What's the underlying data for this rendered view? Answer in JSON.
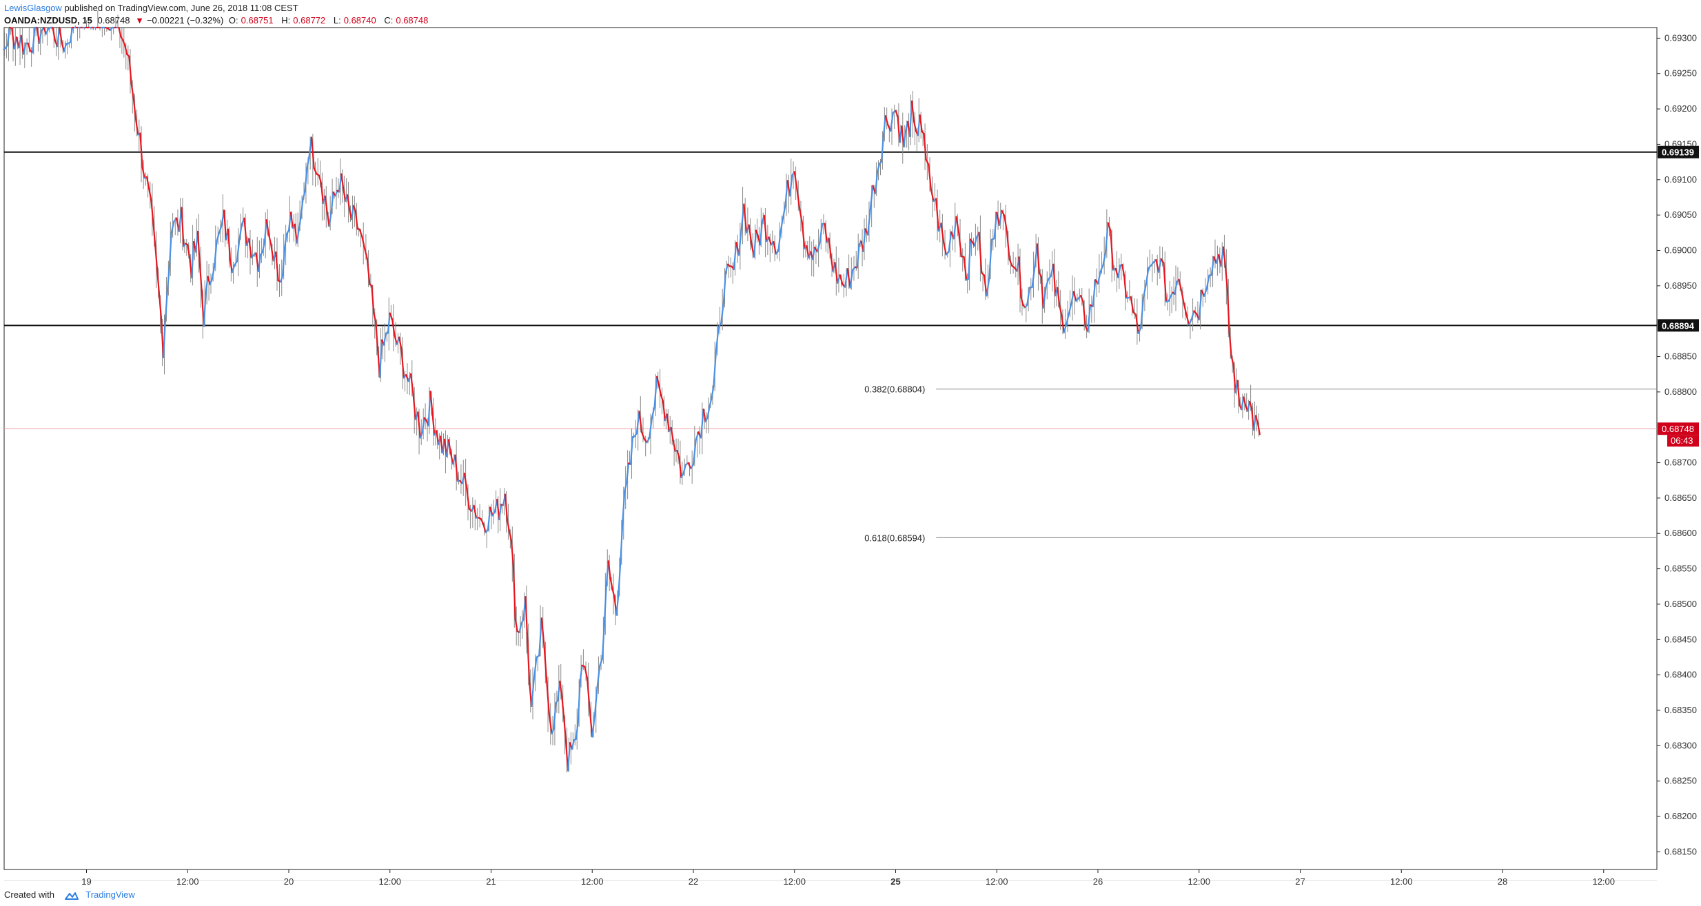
{
  "header": {
    "author": "LewisGlasgow",
    "published_text": " published on TradingView.com, June 26, 2018 11:08 CEST"
  },
  "ticker": {
    "symbol": "OANDA:NZDUSD, 15",
    "last": "0.68748",
    "change": "−0.00221 (−0.32%)",
    "o_label": "O:",
    "o_value": "0.68751",
    "h_label": "H:",
    "h_value": "0.68772",
    "l_label": "L:",
    "l_value": "0.68740",
    "c_label": "C:",
    "c_value": "0.68748",
    "down_icon": "triangle-down-icon"
  },
  "footer": {
    "created_with": "Created with",
    "brand": "TradingView",
    "logo_icon": "tradingview-cloud-icon"
  },
  "colors": {
    "up": "#4a90e2",
    "down": "#e5171f",
    "wick": "#8a8a8a",
    "price_line": "#f3a0a5",
    "last_price_bg": "#d0021b",
    "level_bg": "#111111",
    "grid_axis": "#222222"
  },
  "chart_data": {
    "type": "line",
    "instrument": "OANDA:NZDUSD",
    "timeframe": "15",
    "ylim": [
      0.68125,
      0.69315
    ],
    "y_ticks": [
      "0.69300",
      "0.69250",
      "0.69200",
      "0.69150",
      "0.69100",
      "0.69050",
      "0.69000",
      "0.68950",
      "0.68850",
      "0.68800",
      "0.68700",
      "0.68650",
      "0.68600",
      "0.68550",
      "0.68500",
      "0.68450",
      "0.68400",
      "0.68350",
      "0.68300",
      "0.68250",
      "0.68200",
      "0.68150"
    ],
    "y_tick_values": [
      0.693,
      0.6925,
      0.692,
      0.6915,
      0.691,
      0.6905,
      0.69,
      0.6895,
      0.6885,
      0.688,
      0.687,
      0.6865,
      0.686,
      0.6855,
      0.685,
      0.6845,
      0.684,
      0.6835,
      0.683,
      0.6825,
      0.682,
      0.6815
    ],
    "xlim": [
      -0.5,
      5.9
    ],
    "x_ticks": [
      {
        "label": "19",
        "x": 0,
        "bold": false
      },
      {
        "label": "12:00",
        "x": 0.5,
        "bold": false
      },
      {
        "label": "20",
        "x": 1,
        "bold": false
      },
      {
        "label": "12:00",
        "x": 1.5,
        "bold": false
      },
      {
        "label": "21",
        "x": 2,
        "bold": false
      },
      {
        "label": "12:00",
        "x": 2.5,
        "bold": false
      },
      {
        "label": "22",
        "x": 3,
        "bold": false
      },
      {
        "label": "12:00",
        "x": 3.5,
        "bold": false
      },
      {
        "label": "25",
        "x": 4,
        "bold": true
      },
      {
        "label": "12:00",
        "x": 4.5,
        "bold": false
      },
      {
        "label": "26",
        "x": 5,
        "bold": false
      },
      {
        "label": "12:00",
        "x": 5.5,
        "bold": false
      },
      {
        "label": "27",
        "x": 6,
        "bold": false
      },
      {
        "label": "12:00",
        "x": 6.5,
        "bold": false
      },
      {
        "label": "28",
        "x": 7,
        "bold": false
      },
      {
        "label": "12:00",
        "x": 7.5,
        "bold": false
      }
    ],
    "price_path": [
      [
        -0.5,
        0.6933
      ],
      [
        -0.42,
        0.6927
      ],
      [
        -0.38,
        0.6931
      ],
      [
        -0.3,
        0.6929
      ],
      [
        -0.2,
        0.6932
      ],
      [
        -0.1,
        0.6929
      ],
      [
        -0.05,
        0.6934
      ],
      [
        0.15,
        0.6933
      ],
      [
        0.2,
        0.6928
      ],
      [
        0.32,
        0.6905
      ],
      [
        0.35,
        0.6896
      ],
      [
        0.38,
        0.6887
      ],
      [
        0.42,
        0.6903
      ],
      [
        0.47,
        0.6904
      ],
      [
        0.52,
        0.6898
      ],
      [
        0.55,
        0.6901
      ],
      [
        0.58,
        0.6891
      ],
      [
        0.62,
        0.6898
      ],
      [
        0.68,
        0.6904
      ],
      [
        0.72,
        0.6899
      ],
      [
        0.78,
        0.6903
      ],
      [
        0.85,
        0.6899
      ],
      [
        0.9,
        0.6904
      ],
      [
        0.96,
        0.6896
      ],
      [
        1.0,
        0.6905
      ],
      [
        1.05,
        0.6901
      ],
      [
        1.1,
        0.6915
      ],
      [
        1.15,
        0.6912
      ],
      [
        1.2,
        0.6904
      ],
      [
        1.25,
        0.691
      ],
      [
        1.3,
        0.6905
      ],
      [
        1.35,
        0.6903
      ],
      [
        1.4,
        0.6895
      ],
      [
        1.45,
        0.6884
      ],
      [
        1.5,
        0.689
      ],
      [
        1.58,
        0.6883
      ],
      [
        1.65,
        0.6875
      ],
      [
        1.7,
        0.6878
      ],
      [
        1.75,
        0.6873
      ],
      [
        1.8,
        0.6871
      ],
      [
        1.88,
        0.6866
      ],
      [
        1.95,
        0.6862
      ],
      [
        2.03,
        0.6863
      ],
      [
        2.07,
        0.6866
      ],
      [
        2.09,
        0.6862
      ],
      [
        2.13,
        0.6846
      ],
      [
        2.17,
        0.685
      ],
      [
        2.2,
        0.6835
      ],
      [
        2.25,
        0.6846
      ],
      [
        2.3,
        0.6833
      ],
      [
        2.35,
        0.6838
      ],
      [
        2.38,
        0.6828
      ],
      [
        2.42,
        0.683
      ],
      [
        2.45,
        0.6843
      ],
      [
        2.5,
        0.6832
      ],
      [
        2.55,
        0.6844
      ],
      [
        2.58,
        0.6855
      ],
      [
        2.62,
        0.6849
      ],
      [
        2.65,
        0.6862
      ],
      [
        2.68,
        0.6868
      ],
      [
        2.72,
        0.6876
      ],
      [
        2.77,
        0.6874
      ],
      [
        2.82,
        0.688
      ],
      [
        2.86,
        0.6878
      ],
      [
        2.9,
        0.6874
      ],
      [
        2.95,
        0.6868
      ],
      [
        3.0,
        0.6872
      ],
      [
        3.05,
        0.6877
      ],
      [
        3.1,
        0.688
      ],
      [
        3.15,
        0.6895
      ],
      [
        3.2,
        0.6897
      ],
      [
        3.25,
        0.6906
      ],
      [
        3.3,
        0.69
      ],
      [
        3.35,
        0.6904
      ],
      [
        3.42,
        0.6901
      ],
      [
        3.5,
        0.6913
      ],
      [
        3.55,
        0.6902
      ],
      [
        3.6,
        0.6899
      ],
      [
        3.65,
        0.6903
      ],
      [
        3.7,
        0.6897
      ],
      [
        3.75,
        0.6895
      ],
      [
        3.8,
        0.6898
      ],
      [
        3.85,
        0.6902
      ],
      [
        3.9,
        0.691
      ],
      [
        3.95,
        0.6918
      ],
      [
        4.0,
        0.692
      ],
      [
        4.04,
        0.6915
      ],
      [
        4.08,
        0.6919
      ],
      [
        4.1,
        0.6915
      ],
      [
        4.12,
        0.692
      ],
      [
        4.15,
        0.6912
      ],
      [
        4.2,
        0.6906
      ],
      [
        4.25,
        0.6899
      ],
      [
        4.3,
        0.6905
      ],
      [
        4.35,
        0.6897
      ],
      [
        4.4,
        0.6903
      ],
      [
        4.45,
        0.6893
      ],
      [
        4.5,
        0.6907
      ],
      [
        4.55,
        0.6902
      ],
      [
        4.6,
        0.6898
      ],
      [
        4.65,
        0.6892
      ],
      [
        4.7,
        0.6901
      ],
      [
        4.73,
        0.6894
      ],
      [
        4.78,
        0.6896
      ],
      [
        4.82,
        0.689
      ],
      [
        4.88,
        0.6893
      ],
      [
        4.95,
        0.689
      ],
      [
        5.0,
        0.6896
      ],
      [
        5.05,
        0.6902
      ],
      [
        5.1,
        0.6897
      ],
      [
        5.15,
        0.6894
      ],
      [
        5.2,
        0.6888
      ],
      [
        5.25,
        0.6896
      ],
      [
        5.3,
        0.6899
      ],
      [
        5.35,
        0.6893
      ],
      [
        5.4,
        0.6897
      ],
      [
        5.45,
        0.6891
      ],
      [
        5.5,
        0.6892
      ],
      [
        5.55,
        0.6898
      ],
      [
        5.62,
        0.69
      ],
      [
        5.66,
        0.6885
      ],
      [
        5.7,
        0.6878
      ],
      [
        5.73,
        0.688
      ],
      [
        5.77,
        0.6876
      ],
      [
        5.8,
        0.6874
      ]
    ],
    "horizontal_levels": [
      {
        "price": 0.69139,
        "label": "0.69139"
      },
      {
        "price": 0.68894,
        "label": "0.68894"
      }
    ],
    "fib_levels": [
      {
        "ratio": "0.382",
        "price": 0.68804,
        "label": "0.382(0.68804)",
        "x_start": 4.2
      },
      {
        "ratio": "0.618",
        "price": 0.68594,
        "label": "0.618(0.68594)",
        "x_start": 4.2
      }
    ],
    "last_price": {
      "price": 0.68748,
      "label": "0.68748",
      "countdown": "06:43"
    },
    "grid": false,
    "legend": "none"
  }
}
